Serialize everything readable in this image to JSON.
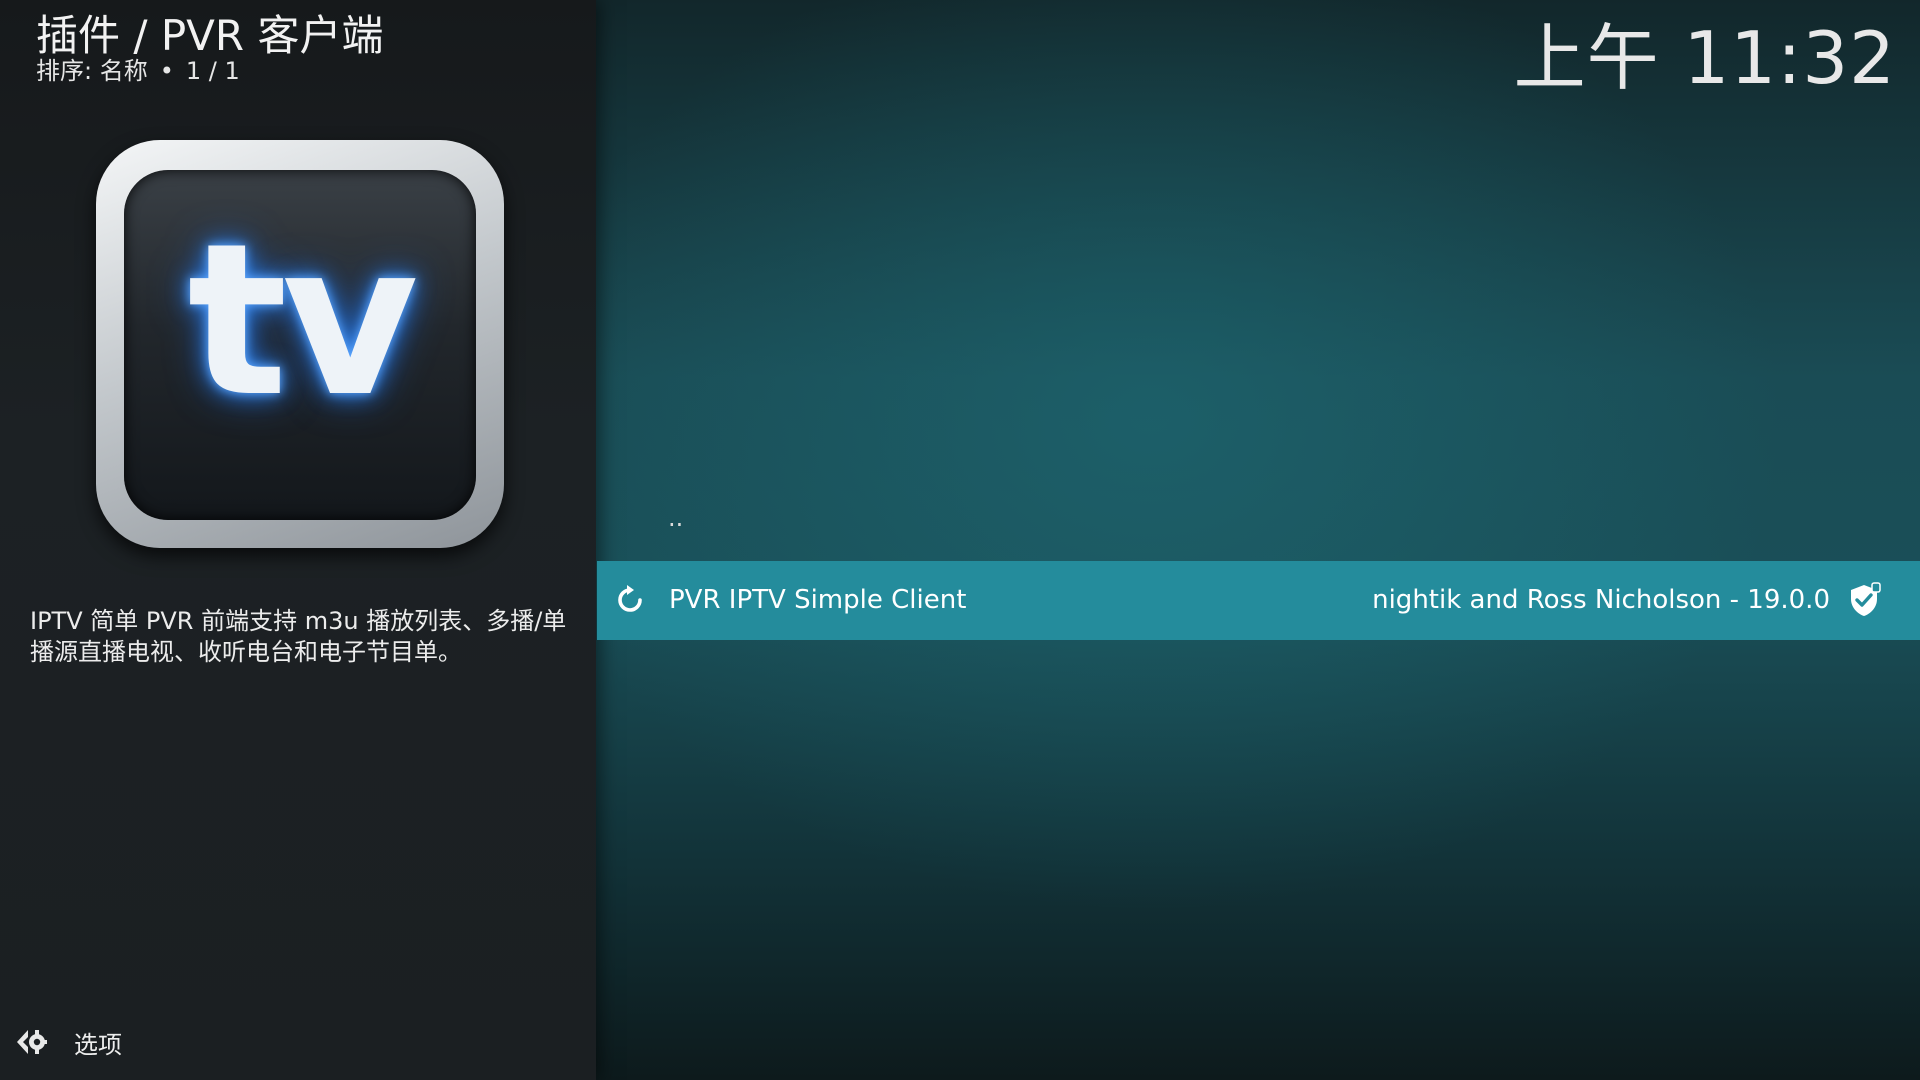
{
  "header": {
    "title": "插件 / PVR 客户端",
    "sort_label": "排序: 名称",
    "separator": "•",
    "page_count": "1 / 1"
  },
  "clock": "上午 11:32",
  "addon": {
    "icon": "tv-icon",
    "icon_text": "tv",
    "description": "IPTV 简单 PVR 前端支持 m3u 播放列表、多播/单播源直播电视、收听电台和电子节目单。"
  },
  "list": {
    "parent_label": "..",
    "items": [
      {
        "name": "PVR IPTV Simple Client",
        "meta": "nightik and Ross Nicholson - 19.0.0",
        "status_icon": "refresh-icon",
        "badge_icon": "shield-check-icon",
        "selected": true
      }
    ]
  },
  "footer": {
    "options_label": "选项",
    "options_icon": "options-icon"
  },
  "colors": {
    "selection": "#248c9c",
    "panel": "#1c2124",
    "tv_glow": "#2f7fe6"
  }
}
